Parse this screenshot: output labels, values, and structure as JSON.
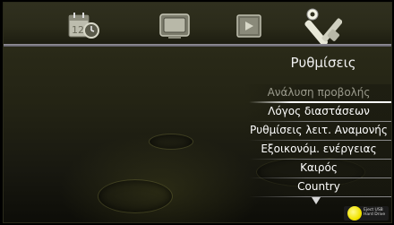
{
  "top_icons": [
    {
      "name": "calendar-clock-icon"
    },
    {
      "name": "tv-icon"
    },
    {
      "name": "media-play-icon"
    },
    {
      "name": "settings-tools-icon"
    }
  ],
  "section_title": "Ρυθμίσεις",
  "menu": {
    "items": [
      {
        "label": "Ανάλυση προβολής"
      },
      {
        "label": "Λόγος διαστάσεων"
      },
      {
        "label": "Ρυθμίσεις λειτ. Αναμονής"
      },
      {
        "label": "Εξοικονόμ. ενέργειας"
      },
      {
        "label": "Καιρός"
      },
      {
        "label": "Country"
      }
    ]
  },
  "scroll_indicator": "more-down-arrow",
  "hint": {
    "button_color": "#f2e400",
    "line1": "Eject USB",
    "line2": "Hard Drive"
  },
  "colors": {
    "accent_bar": "#9a96a0",
    "background": "#2a2a18"
  }
}
